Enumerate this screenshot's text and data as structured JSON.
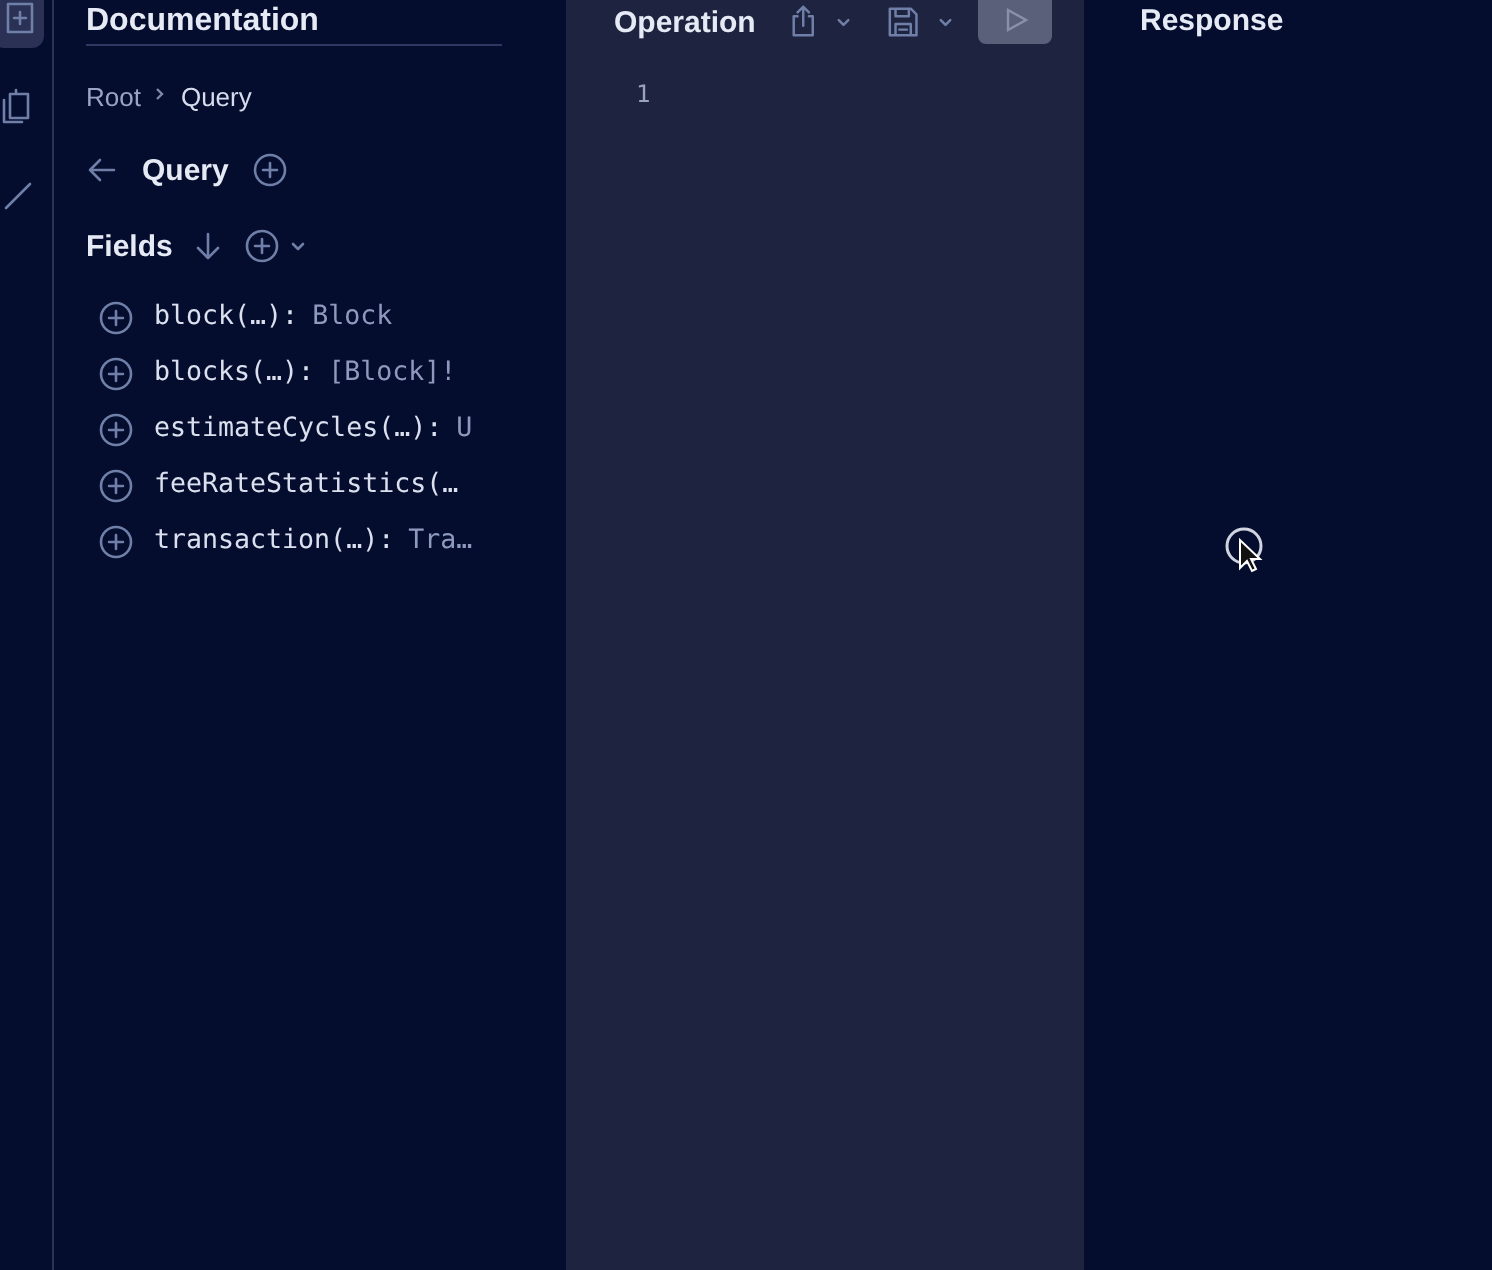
{
  "rail": [
    {
      "kind": "docs",
      "selected": true
    },
    {
      "kind": "history",
      "selected": false
    },
    {
      "kind": "pen",
      "selected": false
    }
  ],
  "docs": {
    "title": "Documentation",
    "breadcrumb": [
      "Root",
      "Query"
    ],
    "heading": "Query",
    "section": "Fields",
    "fields": [
      {
        "name": "block(…):",
        "type": "Block"
      },
      {
        "name": "blocks(…):",
        "type": "[Block]!"
      },
      {
        "name": "estimateCycles(…):",
        "type": "U"
      },
      {
        "name": "feeRateStatistics(…"
      },
      {
        "name": "transaction(…):",
        "type": "Tra…"
      }
    ]
  },
  "editor": {
    "title": "Operation",
    "run_disabled": true,
    "line_numbers": [
      "1"
    ]
  },
  "response": {
    "title": "Response"
  }
}
